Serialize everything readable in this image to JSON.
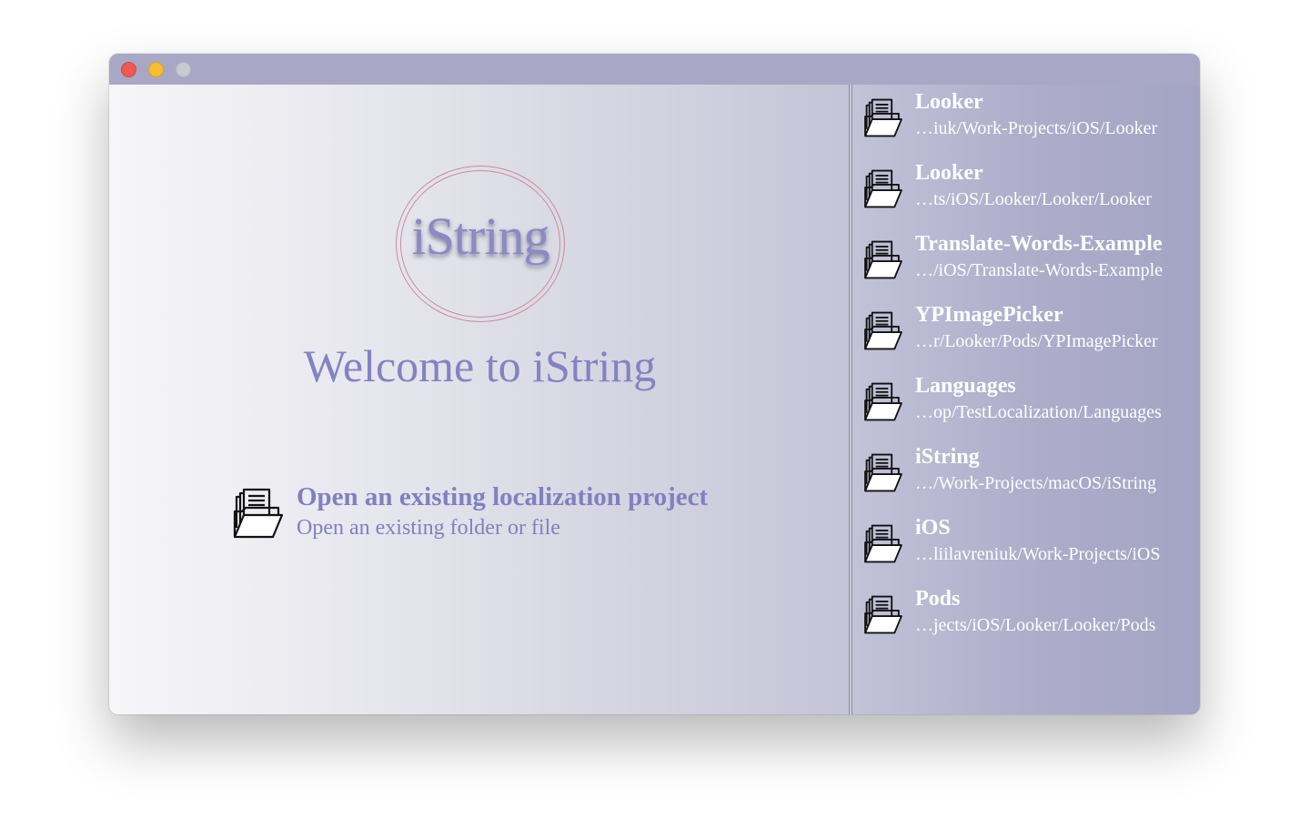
{
  "window": {
    "traffic_lights": [
      "close",
      "minimize",
      "zoom"
    ]
  },
  "logo": {
    "text": "iString"
  },
  "welcome": {
    "title": "Welcome to iString"
  },
  "open_action": {
    "title": "Open an existing localization project",
    "subtitle": "Open an existing folder or file",
    "icon": "folder-documents-icon"
  },
  "recent_projects": [
    {
      "name": "Looker",
      "path": "…iuk/Work-Projects/iOS/Looker"
    },
    {
      "name": "Looker",
      "path": "…ts/iOS/Looker/Looker/Looker"
    },
    {
      "name": "Translate-Words-Example",
      "path": "…/iOS/Translate-Words-Example"
    },
    {
      "name": "YPImagePicker",
      "path": "…r/Looker/Pods/YPImagePicker"
    },
    {
      "name": "Languages",
      "path": "…op/TestLocalization/Languages"
    },
    {
      "name": "iString",
      "path": "…/Work-Projects/macOS/iString"
    },
    {
      "name": "iOS",
      "path": "…liilavreniuk/Work-Projects/iOS"
    },
    {
      "name": "Pods",
      "path": "…jects/iOS/Looker/Looker/Pods"
    }
  ],
  "colors": {
    "accent": "#8383c2",
    "titlebar": "#a8a8c6",
    "sidebar": "#aeaecb",
    "close": "#ee5a52",
    "minimize": "#f6be33",
    "zoom": "#c9c9d0"
  }
}
